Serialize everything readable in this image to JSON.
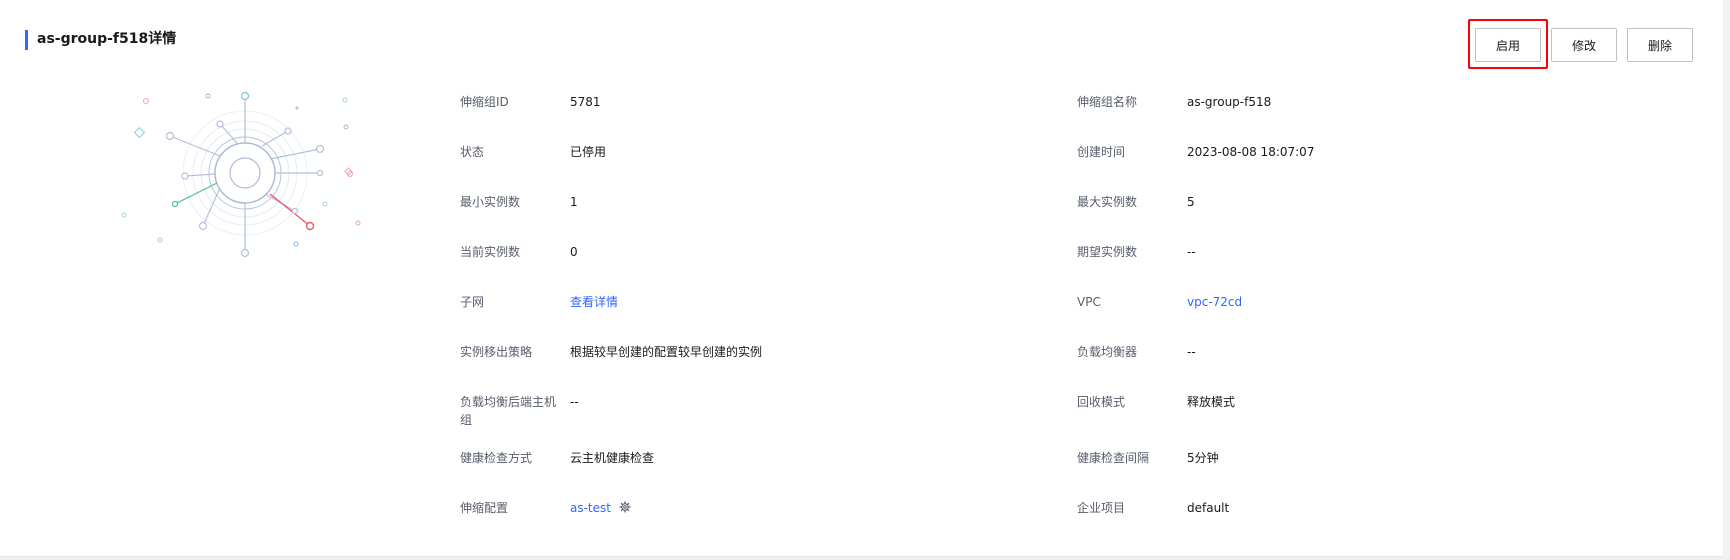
{
  "title": "as-group-f518详情",
  "buttons": {
    "enable": "启用",
    "edit": "修改",
    "delete": "删除"
  },
  "left": {
    "group_id": {
      "label": "伸缩组ID",
      "value": "5781"
    },
    "status": {
      "label": "状态",
      "value": "已停用"
    },
    "min_instances": {
      "label": "最小实例数",
      "value": "1"
    },
    "current_instances": {
      "label": "当前实例数",
      "value": "0"
    },
    "subnet": {
      "label": "子网",
      "value": "查看详情"
    },
    "removal_policy": {
      "label": "实例移出策略",
      "value": "根据较早创建的配置较早创建的实例"
    },
    "lb_backend_group": {
      "label_line1": "负载均衡后端主机",
      "label_line2": "组",
      "value": "--"
    },
    "health_check_method": {
      "label": "健康检查方式",
      "value": "云主机健康检查"
    },
    "scaling_config": {
      "label": "伸缩配置",
      "value": "as-test"
    }
  },
  "right": {
    "group_name": {
      "label": "伸缩组名称",
      "value": "as-group-f518"
    },
    "created_time": {
      "label": "创建时间",
      "value": "2023-08-08 18:07:07"
    },
    "max_instances": {
      "label": "最大实例数",
      "value": "5"
    },
    "desired_instances": {
      "label": "期望实例数",
      "value": "--"
    },
    "vpc": {
      "label": "VPC",
      "value": "vpc-72cd"
    },
    "load_balancer": {
      "label": "负载均衡器",
      "value": "--"
    },
    "recycle_mode": {
      "label": "回收模式",
      "value": "释放模式"
    },
    "health_check_interval": {
      "label": "健康检查间隔",
      "value": "5分钟"
    },
    "enterprise_project": {
      "label": "企业项目",
      "value": "default"
    }
  },
  "colors": {
    "accent": "#3366ff",
    "highlight": "#ff0000"
  },
  "icons": {
    "scaling_config_action": "gear-icon"
  }
}
